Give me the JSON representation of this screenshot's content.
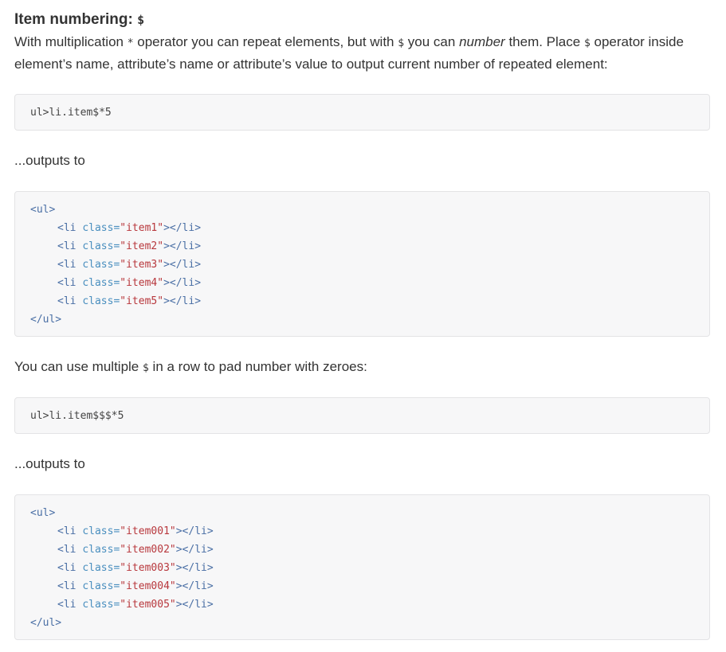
{
  "heading": {
    "text": "Item numbering: ",
    "symbol": "$"
  },
  "intro": {
    "part1": "With multiplication ",
    "op_multiply": "*",
    "part2": " operator you can repeat elements, but with ",
    "op_dollar": "$",
    "part3": " you can ",
    "em": "number",
    "part4": " them. Place ",
    "op_dollar2": "$",
    "part5": " operator inside element’s name, attribute’s name or attribute’s value to output current number of repeated element:"
  },
  "example1": {
    "abbreviation": "ul>li.item$*5"
  },
  "outputs_label_1": "...outputs to",
  "output1": {
    "open": "<ul>",
    "close": "</ul>",
    "items": [
      {
        "tag_open": "<li ",
        "attr": "class=",
        "value": "\"item1\"",
        "tag_close": "></li>"
      },
      {
        "tag_open": "<li ",
        "attr": "class=",
        "value": "\"item2\"",
        "tag_close": "></li>"
      },
      {
        "tag_open": "<li ",
        "attr": "class=",
        "value": "\"item3\"",
        "tag_close": "></li>"
      },
      {
        "tag_open": "<li ",
        "attr": "class=",
        "value": "\"item4\"",
        "tag_close": "></li>"
      },
      {
        "tag_open": "<li ",
        "attr": "class=",
        "value": "\"item5\"",
        "tag_close": "></li>"
      }
    ]
  },
  "pad_text": {
    "part1": "You can use multiple ",
    "symbol": "$",
    "part2": " in a row to pad number with zeroes:"
  },
  "example2": {
    "abbreviation": "ul>li.item$$$*5"
  },
  "outputs_label_2": "...outputs to",
  "output2": {
    "open": "<ul>",
    "close": "</ul>",
    "items": [
      {
        "tag_open": "<li ",
        "attr": "class=",
        "value": "\"item001\"",
        "tag_close": "></li>"
      },
      {
        "tag_open": "<li ",
        "attr": "class=",
        "value": "\"item002\"",
        "tag_close": "></li>"
      },
      {
        "tag_open": "<li ",
        "attr": "class=",
        "value": "\"item003\"",
        "tag_close": "></li>"
      },
      {
        "tag_open": "<li ",
        "attr": "class=",
        "value": "\"item004\"",
        "tag_close": "></li>"
      },
      {
        "tag_open": "<li ",
        "attr": "class=",
        "value": "\"item005\"",
        "tag_close": "></li>"
      }
    ]
  }
}
